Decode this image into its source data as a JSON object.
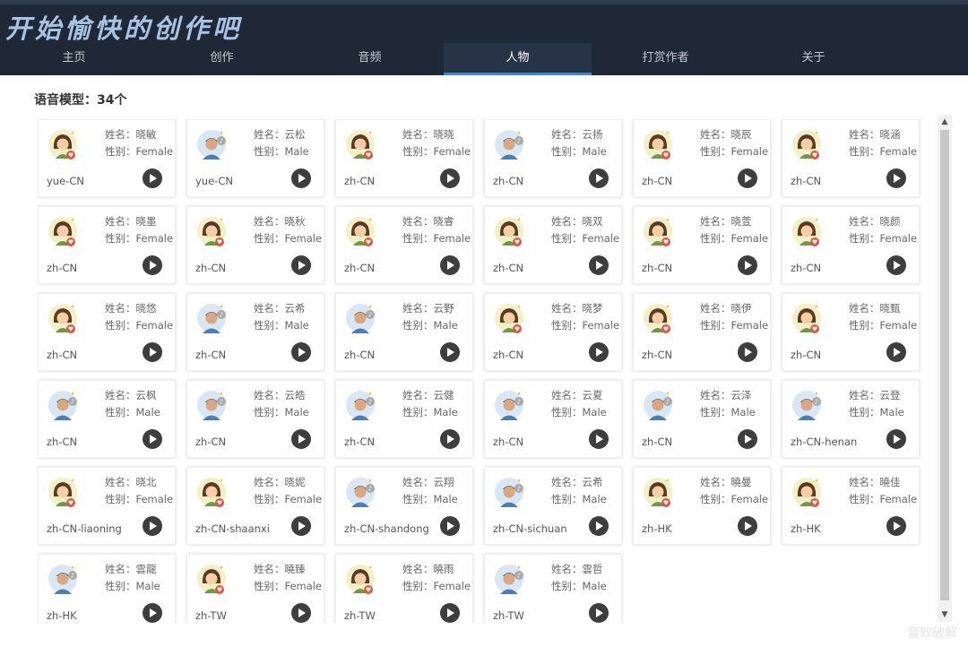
{
  "app": {
    "title": "开始愉快的创作吧"
  },
  "tabs": [
    {
      "label": "主页",
      "active": false
    },
    {
      "label": "创作",
      "active": false
    },
    {
      "label": "音频",
      "active": false
    },
    {
      "label": "人物",
      "active": true
    },
    {
      "label": "打赏作者",
      "active": false
    },
    {
      "label": "关于",
      "active": false
    }
  ],
  "model_count_label": "语音模型：34个",
  "field_labels": {
    "name": "姓名：",
    "gender": "性别："
  },
  "icons": {
    "female_avatar": "female-avatar-icon",
    "male_avatar": "male-avatar-icon",
    "play": "play-icon"
  },
  "colors": {
    "header_bg": "#1f2836",
    "active_tab_underline": "#3c86d8",
    "play_button": "#3e3e3e",
    "female_badge": "#e5543f",
    "male_badge": "#a9a9a9"
  },
  "voices": [
    {
      "name": "晓敏",
      "gender": "Female",
      "locale": "yue-CN"
    },
    {
      "name": "云松",
      "gender": "Male",
      "locale": "yue-CN"
    },
    {
      "name": "晓晓",
      "gender": "Female",
      "locale": "zh-CN"
    },
    {
      "name": "云扬",
      "gender": "Male",
      "locale": "zh-CN"
    },
    {
      "name": "晓辰",
      "gender": "Female",
      "locale": "zh-CN"
    },
    {
      "name": "晓涵",
      "gender": "Female",
      "locale": "zh-CN"
    },
    {
      "name": "晓墨",
      "gender": "Female",
      "locale": "zh-CN"
    },
    {
      "name": "晓秋",
      "gender": "Female",
      "locale": "zh-CN"
    },
    {
      "name": "晓睿",
      "gender": "Female",
      "locale": "zh-CN"
    },
    {
      "name": "晓双",
      "gender": "Female",
      "locale": "zh-CN"
    },
    {
      "name": "晓萱",
      "gender": "Female",
      "locale": "zh-CN"
    },
    {
      "name": "晓颜",
      "gender": "Female",
      "locale": "zh-CN"
    },
    {
      "name": "晓悠",
      "gender": "Female",
      "locale": "zh-CN"
    },
    {
      "name": "云希",
      "gender": "Male",
      "locale": "zh-CN"
    },
    {
      "name": "云野",
      "gender": "Male",
      "locale": "zh-CN"
    },
    {
      "name": "晓梦",
      "gender": "Female",
      "locale": "zh-CN"
    },
    {
      "name": "晓伊",
      "gender": "Female",
      "locale": "zh-CN"
    },
    {
      "name": "晓甄",
      "gender": "Female",
      "locale": "zh-CN"
    },
    {
      "name": "云枫",
      "gender": "Male",
      "locale": "zh-CN"
    },
    {
      "name": "云皓",
      "gender": "Male",
      "locale": "zh-CN"
    },
    {
      "name": "云健",
      "gender": "Male",
      "locale": "zh-CN"
    },
    {
      "name": "云夏",
      "gender": "Male",
      "locale": "zh-CN"
    },
    {
      "name": "云泽",
      "gender": "Male",
      "locale": "zh-CN"
    },
    {
      "name": "云登",
      "gender": "Male",
      "locale": "zh-CN-henan"
    },
    {
      "name": "晓北",
      "gender": "Female",
      "locale": "zh-CN-liaoning"
    },
    {
      "name": "晓妮",
      "gender": "Female",
      "locale": "zh-CN-shaanxi"
    },
    {
      "name": "云翔",
      "gender": "Male",
      "locale": "zh-CN-shandong"
    },
    {
      "name": "云希",
      "gender": "Male",
      "locale": "zh-CN-sichuan"
    },
    {
      "name": "曉曼",
      "gender": "Female",
      "locale": "zh-HK"
    },
    {
      "name": "曉佳",
      "gender": "Female",
      "locale": "zh-HK"
    },
    {
      "name": "雲龍",
      "gender": "Male",
      "locale": "zh-HK"
    },
    {
      "name": "曉臻",
      "gender": "Female",
      "locale": "zh-TW"
    },
    {
      "name": "曉雨",
      "gender": "Female",
      "locale": "zh-TW"
    },
    {
      "name": "雲哲",
      "gender": "Male",
      "locale": "zh-TW"
    }
  ],
  "scrollbar": {
    "up_glyph": "▲",
    "down_glyph": "▼"
  },
  "watermark": "音效破解"
}
